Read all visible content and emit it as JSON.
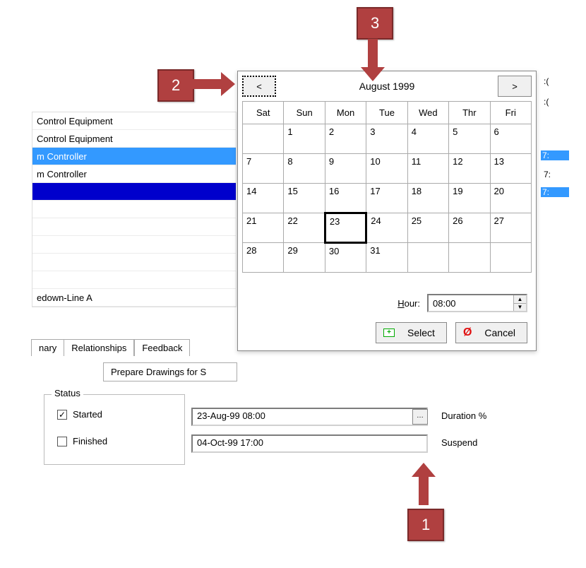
{
  "list": {
    "items": [
      {
        "label": "Control Equipment",
        "style": "plain"
      },
      {
        "label": "Control Equipment",
        "style": "plain"
      },
      {
        "label": "m Controller",
        "style": "hl"
      },
      {
        "label": "m Controller",
        "style": "plain"
      },
      {
        "label": "",
        "style": "solid"
      },
      {
        "label": "",
        "style": "plain"
      },
      {
        "label": "",
        "style": "plain"
      },
      {
        "label": "",
        "style": "plain"
      },
      {
        "label": "",
        "style": "plain"
      },
      {
        "label": "",
        "style": "plain"
      },
      {
        "label": "edown-Line A",
        "style": "plain"
      }
    ]
  },
  "tabs": {
    "a": "nary",
    "b": "Relationships",
    "c": "Feedback"
  },
  "subbar": {
    "text": "Prepare Drawings for S"
  },
  "status": {
    "legend": "Status",
    "started_label": "Started",
    "finished_label": "Finished",
    "started_checked": true,
    "finished_checked": false
  },
  "fields": {
    "started_value": "23-Aug-99 08:00",
    "finished_value": "04-Oct-99 17:00",
    "duration_label": "Duration %",
    "suspend_label": "Suspend"
  },
  "right_times": {
    "a": ":(",
    "b": ":(",
    "hl1": "7:",
    "c": "7:",
    "hl2": "7:"
  },
  "picker": {
    "prev": "<",
    "next": ">",
    "title": "August 1999",
    "days": [
      "Sat",
      "Sun",
      "Mon",
      "Tue",
      "Wed",
      "Thr",
      "Fri"
    ],
    "weeks": [
      [
        "",
        "1",
        "2",
        "3",
        "4",
        "5",
        "6"
      ],
      [
        "7",
        "8",
        "9",
        "10",
        "11",
        "12",
        "13"
      ],
      [
        "14",
        "15",
        "16",
        "17",
        "18",
        "19",
        "20"
      ],
      [
        "21",
        "22",
        "23",
        "24",
        "25",
        "26",
        "27"
      ],
      [
        "28",
        "29",
        "30",
        "31",
        "",
        "",
        ""
      ]
    ],
    "selected": "23",
    "hour_label_pre": "H",
    "hour_label_rest": "our:",
    "hour_value": "08:00",
    "select_label": "Select",
    "cancel_label": "Cancel"
  },
  "callouts": {
    "c1": "1",
    "c2": "2",
    "c3": "3"
  }
}
